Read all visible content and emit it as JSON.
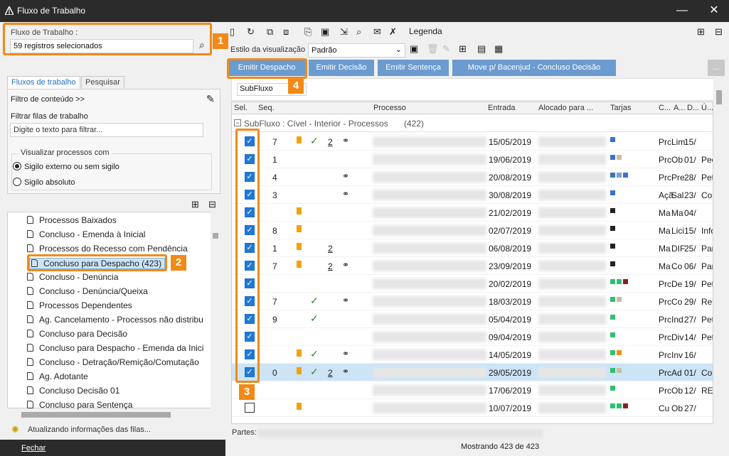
{
  "window": {
    "title": "Fluxo de Trabalho",
    "minimize": "—",
    "maximize": "☐",
    "close": "✕"
  },
  "left": {
    "fluxo_label": "Fluxo de Trabalho :",
    "fluxo_value": "59 registros selecionados",
    "tabs": [
      "Fluxos de trabalho",
      "Pesquisar"
    ],
    "filter_content": "Filtro de conteúdo >>",
    "filter_queues": "Filtrar filas de trabalho",
    "filter_placeholder": "Digite o texto para filtrar...",
    "view_group": "Visualizar processos com",
    "radio1": "Sigilo externo ou sem sigilo",
    "radio2": "Sigilo absoluto",
    "tree": [
      "Processos Baixados",
      "Concluso - Emenda à Inicial",
      "Processos do Recesso com Pendência",
      "Concluso para Despacho (423)",
      "Concluso - Denúncia",
      "Concluso - Denúncia/Queixa",
      "Processos Dependentes",
      "Ag. Cancelamento - Processos não distribu",
      "Concluso para Decisão",
      "Concluso para Despacho - Emenda da Inici",
      "Concluso - Detração/Remição/Comutação",
      "Ag. Adotante",
      "Concluso Decisão 01",
      "Concluso para Sentença"
    ],
    "status": "Atualizando informações das filas...",
    "close": "Fechar"
  },
  "right": {
    "legenda": "Legenda",
    "estilo_label": "Estilo da visualização",
    "estilo_value": "Padrão",
    "actions": [
      "Emitir Despacho",
      "Emitir Decisão",
      "Emitir Sentença",
      "Move p/ Bacenjud - Concluso Decisão"
    ],
    "more": "...",
    "group_by": "SubFluxo",
    "headers": {
      "sel": "Sel.",
      "seq": "Seq.",
      "processo": "Processo",
      "entrada": "Entrada",
      "alocado": "Alocado para ...",
      "tarjas": "Tarjas",
      "c": "C...",
      "a": "A...",
      "d": "D...",
      "u": "Ú..."
    },
    "group_title": "SubFluxo : Cível - Interior - Processos",
    "group_count": "(422)",
    "rows": [
      {
        "seq": "7",
        "bm": true,
        "ck": true,
        "num": "2",
        "lk": true,
        "date": "15/05/2019",
        "c": "Prc",
        "a": "Lim",
        "d": "15/",
        "u": "",
        "tags": [
          "#3a72c8"
        ],
        "checked": true
      },
      {
        "seq": "1",
        "bm": false,
        "ck": false,
        "num": "",
        "lk": false,
        "date": "19/06/2019",
        "c": "Prc",
        "a": "Ob",
        "d": "01/",
        "u": "Pec",
        "tags": [
          "#3a72c8",
          "#c8bea0"
        ],
        "checked": true
      },
      {
        "seq": "4",
        "bm": false,
        "ck": false,
        "num": "",
        "lk": true,
        "date": "20/08/2019",
        "c": "Prc",
        "a": "Pre",
        "d": "28/",
        "u": "Pet",
        "tags": [
          "#3a72c8",
          "#7aa0d8",
          "#3a72c8"
        ],
        "checked": true
      },
      {
        "seq": "3",
        "bm": false,
        "ck": false,
        "num": "",
        "lk": true,
        "date": "30/08/2019",
        "c": "Açã",
        "a": "Sal",
        "d": "23/",
        "u": "Co",
        "tags": [
          "#3a72c8"
        ],
        "checked": true
      },
      {
        "seq": "",
        "bm": true,
        "ck": false,
        "num": "",
        "lk": false,
        "date": "21/02/2019",
        "c": "Ma",
        "a": "Ma",
        "d": "04/",
        "u": "",
        "tags": [
          "#222222"
        ],
        "checked": true
      },
      {
        "seq": "8",
        "bm": true,
        "ck": false,
        "num": "",
        "lk": false,
        "date": "02/07/2019",
        "c": "Ma",
        "a": "Lici",
        "d": "15/",
        "u": "Info",
        "tags": [
          "#222222"
        ],
        "checked": true
      },
      {
        "seq": "1",
        "bm": true,
        "ck": false,
        "num": "2",
        "lk": false,
        "date": "06/08/2019",
        "c": "Ma",
        "a": "DIF",
        "d": "25/",
        "u": "Par",
        "tags": [
          "#222222"
        ],
        "checked": true
      },
      {
        "seq": "7",
        "bm": true,
        "ck": false,
        "num": "2",
        "lk": true,
        "date": "23/09/2019",
        "c": "Ma",
        "a": "Co",
        "d": "06/",
        "u": "Par",
        "tags": [
          "#222222"
        ],
        "checked": true
      },
      {
        "seq": "",
        "bm": false,
        "ck": false,
        "num": "",
        "lk": false,
        "date": "20/02/2019",
        "c": "Prc",
        "a": "De",
        "d": "19/",
        "u": "Pet",
        "tags": [
          "#2fbf71",
          "#2fbf71",
          "#8b1e1e"
        ],
        "checked": true
      },
      {
        "seq": "7",
        "bm": false,
        "ck": true,
        "num": "",
        "lk": true,
        "date": "18/03/2019",
        "c": "Prc",
        "a": "Co",
        "d": "29/",
        "u": "Ret",
        "tags": [
          "#2fbf71",
          "#c8bea0"
        ],
        "checked": true
      },
      {
        "seq": "9",
        "bm": false,
        "ck": true,
        "num": "",
        "lk": false,
        "date": "05/04/2019",
        "c": "Prc",
        "a": "Ind",
        "d": "27/",
        "u": "Pet",
        "tags": [
          "#2fbf71"
        ],
        "checked": true
      },
      {
        "seq": "",
        "bm": false,
        "ck": false,
        "num": "",
        "lk": false,
        "date": "09/04/2019",
        "c": "Prc",
        "a": "Div",
        "d": "14/",
        "u": "Pet",
        "tags": [
          "#2fbf71"
        ],
        "checked": true
      },
      {
        "seq": "",
        "bm": true,
        "ck": true,
        "num": "",
        "lk": true,
        "date": "14/05/2019",
        "c": "Prc",
        "a": "Inv",
        "d": "16/",
        "u": "",
        "tags": [
          "#2fbf71",
          "#f28a17"
        ],
        "checked": true
      },
      {
        "seq": "0",
        "bm": true,
        "ck": true,
        "num": "2",
        "lk": true,
        "date": "29/05/2019",
        "c": "Prc",
        "a": "Ad",
        "d": "01/",
        "u": "Co",
        "tags": [
          "#2fbf71",
          "#c8bea0"
        ],
        "checked": true,
        "sel": true
      },
      {
        "seq": "",
        "bm": false,
        "ck": false,
        "num": "",
        "lk": false,
        "date": "17/06/2019",
        "c": "Prc",
        "a": "Ob",
        "d": "12/",
        "u": "REC",
        "tags": [
          "#2fbf71"
        ],
        "checked": false
      },
      {
        "seq": "",
        "bm": true,
        "ck": false,
        "num": "",
        "lk": false,
        "date": "10/07/2019",
        "c": "Cu",
        "a": "Ob",
        "d": "27/",
        "u": "",
        "tags": [
          "#2fbf71",
          "#2fbf71",
          "#8b1e1e"
        ],
        "checked": false
      }
    ],
    "partes_label": "Partes:",
    "footer": "Mostrando 423 de 423"
  },
  "callouts": [
    "1",
    "2",
    "3",
    "4"
  ]
}
